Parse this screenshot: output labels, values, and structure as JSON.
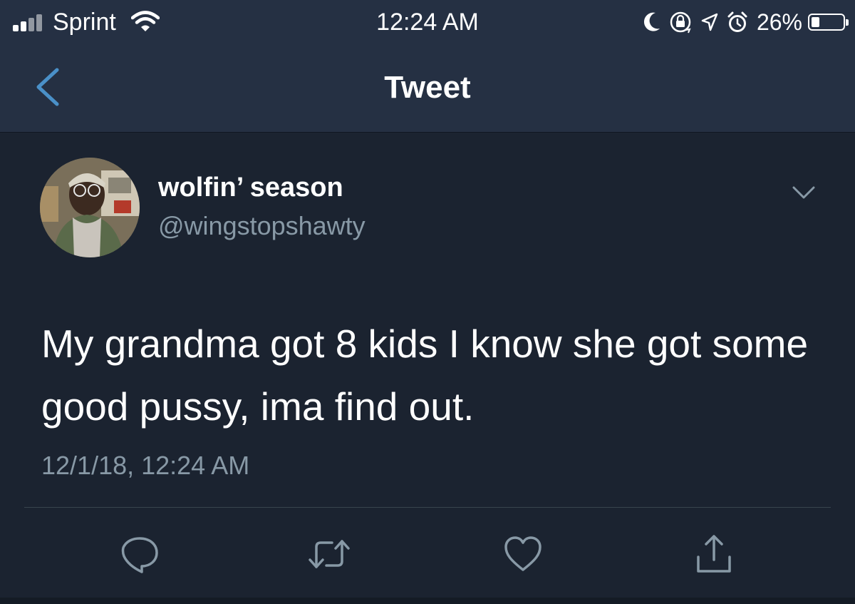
{
  "status_bar": {
    "carrier": "Sprint",
    "time": "12:24 AM",
    "battery_percent": "26%",
    "battery_level": 0.26,
    "icons": [
      "signal-icon",
      "wifi-icon",
      "moon-icon",
      "orientation-lock-icon",
      "location-icon",
      "alarm-icon",
      "battery-icon"
    ]
  },
  "nav": {
    "title": "Tweet",
    "back_icon": "chevron-left-icon"
  },
  "tweet": {
    "display_name": "wolfin’ season",
    "handle": "@wingstopshawty",
    "text": "My grandma got 8 kids I know she got some good pussy, ima find out.",
    "timestamp": "12/1/18, 12:24 AM",
    "menu_icon": "chevron-down-icon"
  },
  "actions": [
    "reply-icon",
    "retweet-icon",
    "like-icon",
    "share-icon"
  ],
  "colors": {
    "background": "#1b2330",
    "bar": "#253043",
    "secondary_text": "#8899a6",
    "icon": "#8899a6",
    "accent": "#4a90c8"
  }
}
